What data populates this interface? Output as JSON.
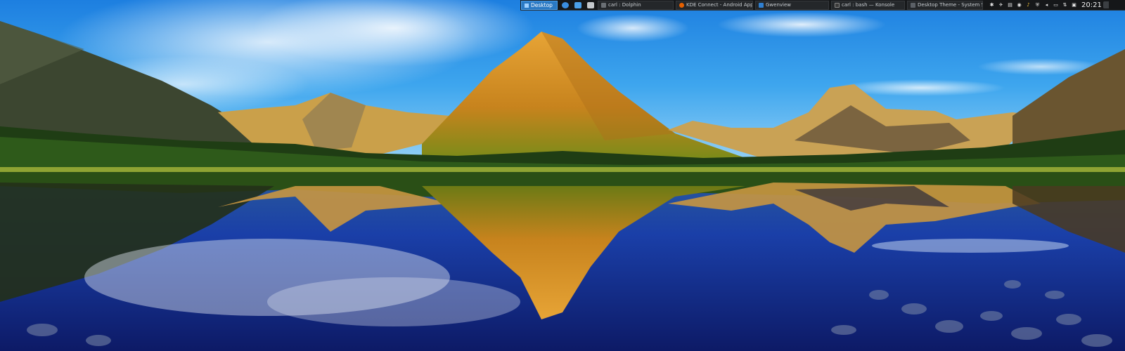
{
  "desktop": {
    "pager_label": "Desktop"
  },
  "launchers": [
    "kde-menu-icon",
    "show-desktop-icon",
    "folder-icon"
  ],
  "taskbar": [
    {
      "label": "carl : Dolphin",
      "icon": "dolphin-icon",
      "color": "#6a6f74"
    },
    {
      "label": "KDE Connect - Android Apps on Google Play - Mozilla Firefox",
      "icon": "firefox-icon",
      "color": "#e66000"
    },
    {
      "label": "Gwenview",
      "icon": "gwenview-icon",
      "color": "#2f7fd0"
    },
    {
      "label": "carl : bash — Konsole",
      "icon": "konsole-icon",
      "color": "#3a3a3a"
    },
    {
      "label": "Desktop Theme - System Settings",
      "icon": "settings-icon",
      "color": "#5b6066"
    }
  ],
  "tray": [
    {
      "icon": "kdeconnect-icon",
      "glyph": "✱"
    },
    {
      "icon": "network-icon",
      "glyph": "✈"
    },
    {
      "icon": "printer-icon",
      "glyph": "▤"
    },
    {
      "icon": "klipper-icon",
      "glyph": "◉"
    },
    {
      "icon": "music-icon",
      "glyph": "♪"
    },
    {
      "icon": "updates-icon",
      "glyph": "⛨"
    },
    {
      "icon": "volume-icon",
      "glyph": "◂"
    },
    {
      "icon": "battery-icon",
      "glyph": "▭"
    },
    {
      "icon": "transfer-icon",
      "glyph": "⇅"
    },
    {
      "icon": "notifications-icon",
      "glyph": "▣"
    }
  ],
  "clock": "20:21",
  "colors": {
    "panel_bg": "#151719",
    "pager_active": "#2a79c4",
    "sky_top": "#2d8fe6",
    "lake_deep": "#12207a"
  }
}
